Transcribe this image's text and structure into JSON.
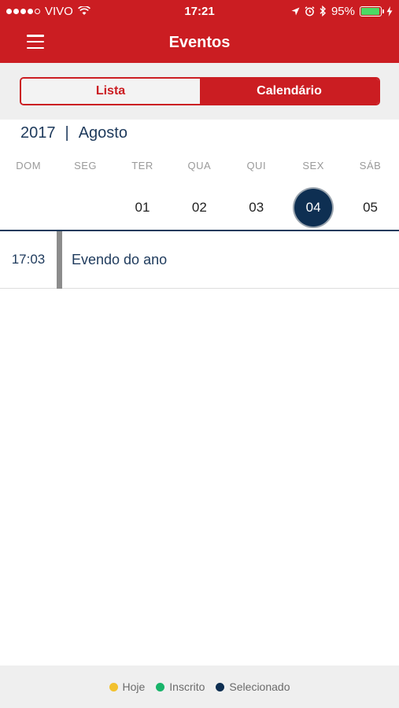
{
  "status": {
    "carrier": "VIVO",
    "time": "17:21",
    "battery_percent": "95%",
    "battery_level": 0.95
  },
  "nav": {
    "title": "Eventos"
  },
  "segment": {
    "lista_label": "Lista",
    "calendario_label": "Calendário",
    "selected": "Calendário"
  },
  "calendar": {
    "year": "2017",
    "separator": "|",
    "month": "Agosto",
    "weekdays": [
      "DOM",
      "SEG",
      "TER",
      "QUA",
      "QUI",
      "SEX",
      "SÁB"
    ],
    "days": [
      "",
      "",
      "01",
      "02",
      "03",
      "04",
      "05"
    ],
    "selected_day": "04"
  },
  "events": [
    {
      "time": "17:03",
      "title": "Evendo do ano"
    }
  ],
  "legend": {
    "items": [
      {
        "label": "Hoje",
        "color": "#f2c12e"
      },
      {
        "label": "Inscrito",
        "color": "#19b46a"
      },
      {
        "label": "Selecionado",
        "color": "#0e2f52"
      }
    ]
  },
  "colors": {
    "brand": "#cb1d22",
    "accent_dark": "#0e2f52"
  },
  "icons": {
    "menu": "hamburger-menu-icon",
    "wifi": "wifi-icon",
    "location": "location-arrow-icon",
    "alarm": "alarm-clock-icon",
    "bluetooth": "bluetooth-icon",
    "battery": "battery-icon",
    "charging": "lightning-bolt-icon"
  }
}
